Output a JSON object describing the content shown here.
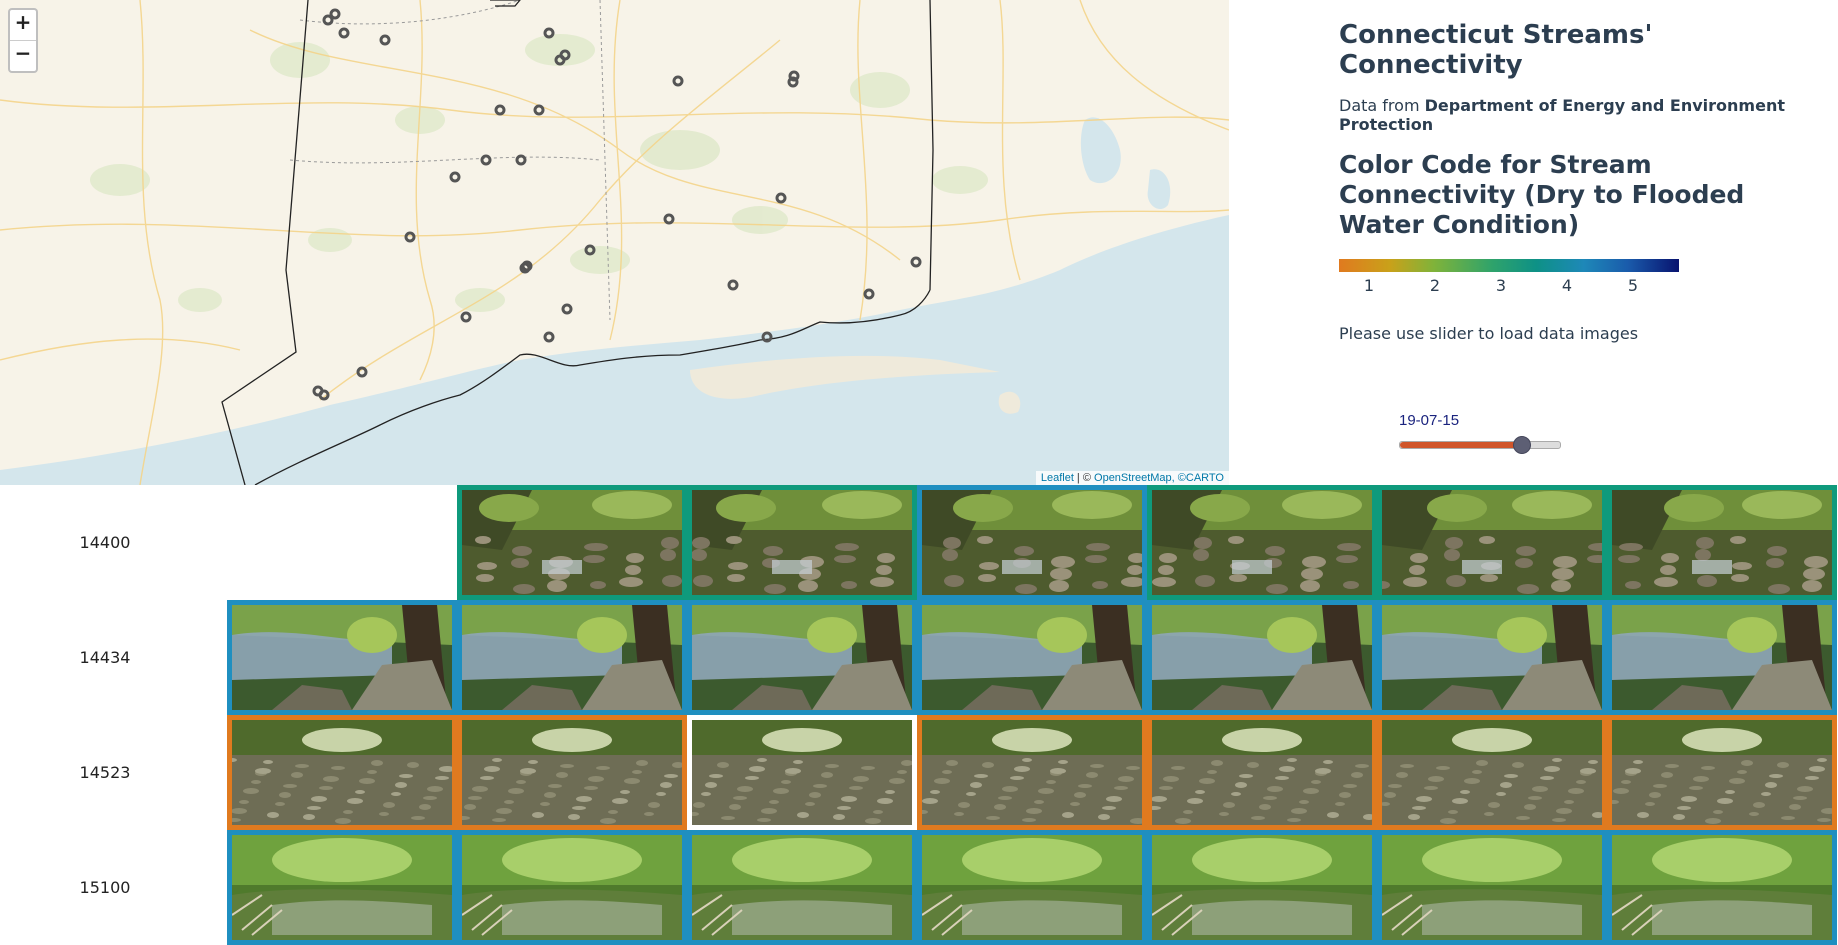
{
  "map": {
    "zoom_in": "+",
    "zoom_out": "−",
    "attribution": {
      "leaflet": "Leaflet",
      "sep": " | © ",
      "osm": "OpenStreetMap",
      "carto": ", ©CARTO"
    },
    "markers_count_note": ""
  },
  "sidebar": {
    "title": "Connecticut Streams' Connectivity",
    "source_prefix": "Data from ",
    "source_org": "Department of Energy and Environment Protection",
    "legend_title": "Color Code for Stream Connectivity (Dry to Flooded Water Condition)",
    "legend_ticks": [
      "1",
      "2",
      "3",
      "4",
      "5"
    ],
    "hint": "Please use slider to load data images"
  },
  "slider": {
    "value_label": "19-07-15",
    "position_fraction": 0.75
  },
  "colors": {
    "teal": "#0f9a7c",
    "blue": "#1f8fc0",
    "orange": "#e07a1f",
    "white": "#ffffff"
  },
  "grid": {
    "rows": [
      {
        "site": "14400",
        "scene": "rocky-creek",
        "frames": [
          null,
          "teal",
          "teal",
          "blue",
          "teal",
          "teal",
          "teal"
        ]
      },
      {
        "site": "14434",
        "scene": "tree-pool",
        "frames": [
          "blue",
          "blue",
          "blue",
          "blue",
          "blue",
          "blue",
          "blue"
        ]
      },
      {
        "site": "14523",
        "scene": "dry-bed",
        "frames": [
          "orange",
          "orange",
          "white",
          "orange",
          "orange",
          "orange",
          "orange"
        ]
      },
      {
        "site": "15100",
        "scene": "forest-stream",
        "frames": [
          "blue",
          "blue",
          "blue",
          "blue",
          "blue",
          "blue",
          "blue"
        ]
      }
    ]
  }
}
